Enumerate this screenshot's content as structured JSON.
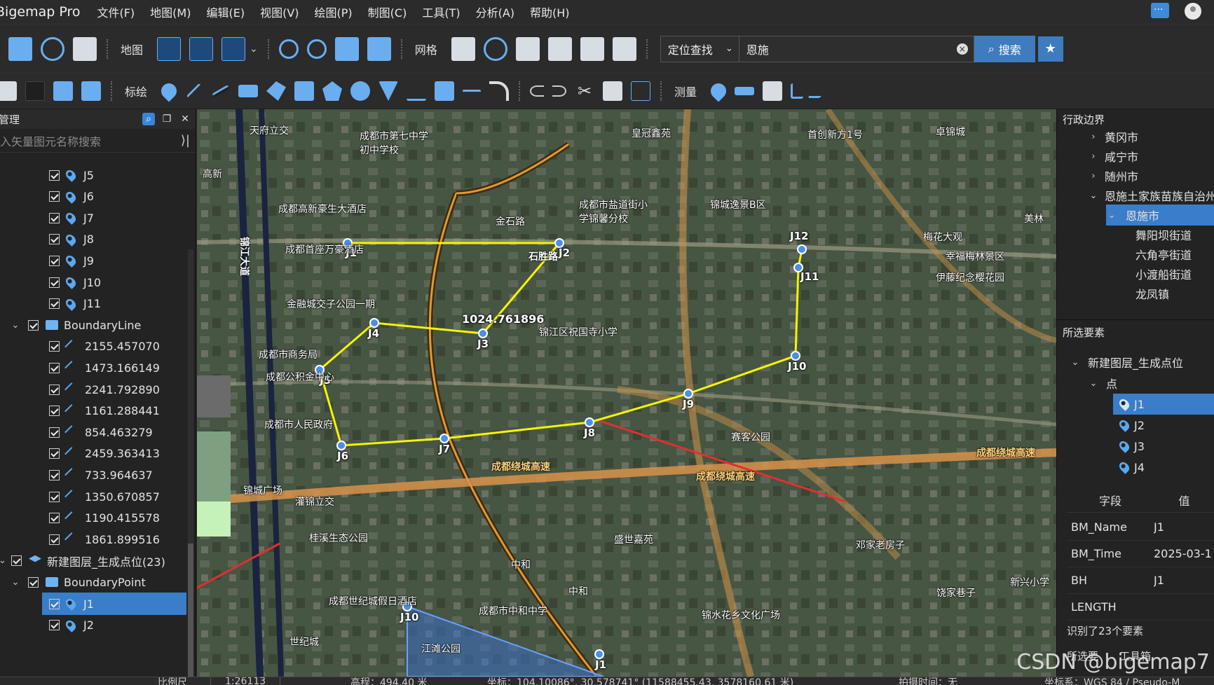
{
  "app": {
    "title": "Bigemap Pro"
  },
  "menu": [
    "文件(F)",
    "地图(M)",
    "编辑(E)",
    "视图(V)",
    "绘图(P)",
    "制图(C)",
    "工具(T)",
    "分析(A)",
    "帮助(H)"
  ],
  "toolbar1": {
    "map_label": "地图",
    "grid_label": "网格",
    "search_type": "定位查找",
    "search_value": "恩施",
    "search_button": "搜索"
  },
  "toolbar2": {
    "draw_label": "标绘",
    "measure_label": "测量"
  },
  "left_panel": {
    "title": "管理",
    "search_placeholder": "入矢量图元名称搜索",
    "rows": [
      {
        "indent": 1,
        "icon": "pin",
        "label": "J5"
      },
      {
        "indent": 1,
        "icon": "pin",
        "label": "J6"
      },
      {
        "indent": 1,
        "icon": "pin",
        "label": "J7"
      },
      {
        "indent": 1,
        "icon": "pin",
        "label": "J8"
      },
      {
        "indent": 1,
        "icon": "pin",
        "label": "J9"
      },
      {
        "indent": 1,
        "icon": "pin",
        "label": "J10"
      },
      {
        "indent": 1,
        "icon": "pin",
        "label": "J11"
      },
      {
        "indent": 0,
        "icon": "folder",
        "label": "BoundaryLine",
        "chev": "⌄"
      },
      {
        "indent": 1,
        "icon": "line",
        "label": "2155.457070"
      },
      {
        "indent": 1,
        "icon": "line",
        "label": "1473.166149"
      },
      {
        "indent": 1,
        "icon": "line",
        "label": "2241.792890"
      },
      {
        "indent": 1,
        "icon": "line",
        "label": "1161.288441"
      },
      {
        "indent": 1,
        "icon": "line",
        "label": "854.463279"
      },
      {
        "indent": 1,
        "icon": "line",
        "label": "2459.363413"
      },
      {
        "indent": 1,
        "icon": "line",
        "label": "733.964637"
      },
      {
        "indent": 1,
        "icon": "line",
        "label": "1350.670857"
      },
      {
        "indent": 1,
        "icon": "line",
        "label": "1190.415578"
      },
      {
        "indent": 1,
        "icon": "line",
        "label": "1861.899516"
      },
      {
        "indent": -1,
        "icon": "layer",
        "label": "新建图层_生成点位(23)"
      },
      {
        "indent": 0,
        "icon": "folder",
        "label": "BoundaryPoint",
        "chev": "⌄"
      },
      {
        "indent": 1,
        "icon": "pin",
        "label": "J1",
        "selected": true
      },
      {
        "indent": 1,
        "icon": "pin",
        "label": "J2"
      }
    ]
  },
  "right_panel": {
    "admin_title": "行政边界",
    "admin_rows": [
      {
        "chev": "›",
        "label": "黄冈市",
        "level": 1
      },
      {
        "chev": "›",
        "label": "咸宁市",
        "level": 1
      },
      {
        "chev": "›",
        "label": "随州市",
        "level": 1
      },
      {
        "chev": "⌄",
        "label": "恩施土家族苗族自治州",
        "level": 1
      },
      {
        "chev": "⌄",
        "label": "恩施市",
        "level": 2,
        "selected": true
      },
      {
        "chev": "",
        "label": "舞阳坝街道",
        "level": 3
      },
      {
        "chev": "",
        "label": "六角亭街道",
        "level": 3
      },
      {
        "chev": "",
        "label": "小渡船街道",
        "level": 3
      },
      {
        "chev": "",
        "label": "龙凤镇",
        "level": 3
      }
    ],
    "selected_title": "所选要素",
    "selected_rows": [
      {
        "chev": "⌄",
        "label": "新建图层_生成点位",
        "level": 1
      },
      {
        "chev": "⌄",
        "label": "点",
        "level": 2
      },
      {
        "chev": "",
        "label": "J1",
        "level": 3,
        "selected": true,
        "pin": true
      },
      {
        "chev": "",
        "label": "J2",
        "level": 3,
        "pin": true
      },
      {
        "chev": "",
        "label": "J3",
        "level": 3,
        "pin": true
      },
      {
        "chev": "",
        "label": "J4",
        "level": 3,
        "pin": true
      }
    ],
    "grid_head": [
      "字段",
      "值"
    ],
    "grid_rows": [
      {
        "k": "BM_Name",
        "v": "J1"
      },
      {
        "k": "BM_Time",
        "v": "2025-03-1"
      },
      {
        "k": "BH",
        "v": "J1"
      },
      {
        "k": "LENGTH",
        "v": ""
      }
    ],
    "count_text": "识别了23个要素",
    "tabs": [
      "所选要",
      "工具箱"
    ]
  },
  "status": {
    "scale_label": "比例尺",
    "scale_value": "1:26113",
    "elevation": "高程：494.40 米",
    "coords": "坐标：104.10086°, 30.578741° (11588455.43, 3578160.61 米)",
    "capture_time": "拍摄时间：无",
    "crs": "坐标系：WGS 84 / Pseudo-M"
  },
  "watermark": "CSDN @bigemap7",
  "map": {
    "point_labels": [
      "J1",
      "J2",
      "J3",
      "J4",
      "J5",
      "J6",
      "J7",
      "J8",
      "J9",
      "J10",
      "J11",
      "J12",
      "J10",
      "J1"
    ],
    "measure_label": "1024.761896",
    "place_labels": [
      "天府立交",
      "成都市第七中学初中学校",
      "皇冠鑫苑",
      "首创新方1号",
      "卓锦城",
      "成都高新豪生大酒店",
      "金石路",
      "成都市盐道街小学锦馨分校",
      "锦城逸景B区",
      "成都首座万豪酒店",
      "石胜路",
      "梅花大观",
      "幸福梅林景区",
      "伊藤纪念樱花园",
      "金融城交子公园一期",
      "锦江区祝国寺小学",
      "成都市商务局",
      "成都公积金中心",
      "成都市人民政府",
      "赛客公园",
      "成都绕城高速",
      "成都绕城高速",
      "成都绕城高速",
      "锦城广场",
      "灌锦立交",
      "桂溪生态公园",
      "盛世嘉苑",
      "邓家老房子",
      "中和",
      "中和",
      "成都世纪城假日酒店",
      "成都市中和中学",
      "锦水花乡文化广场",
      "饶家巷子",
      "江滩公园",
      "世纪城",
      "新兴小学",
      "美林",
      "高新",
      "锦江大道"
    ]
  }
}
